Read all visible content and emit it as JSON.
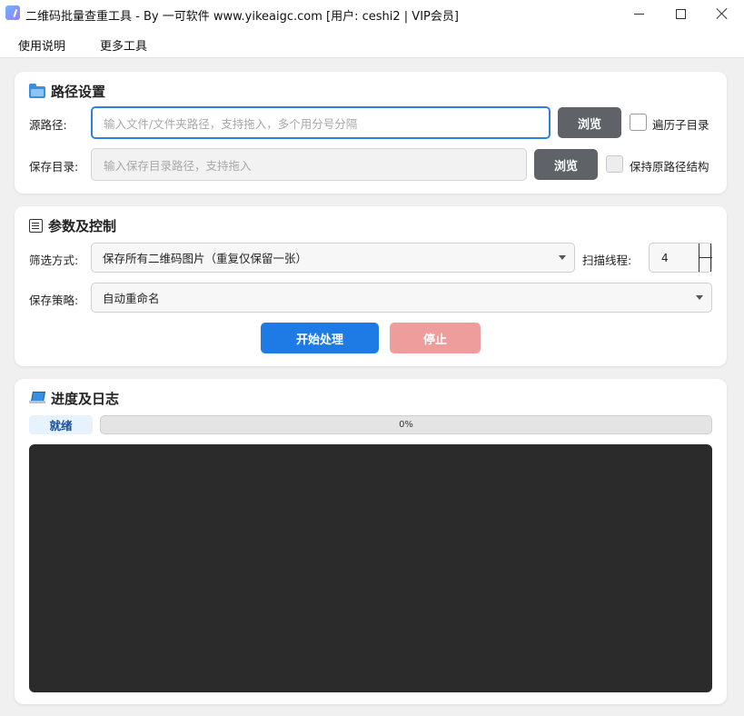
{
  "window": {
    "title": "二维码批量查重工具 - By 一可软件 www.yikeaigc.com  [用户: ceshi2 | VIP会员]",
    "controls": [
      "minimize-icon",
      "maximize-icon",
      "close-icon"
    ]
  },
  "menu": {
    "items": [
      "使用说明",
      "更多工具"
    ]
  },
  "path_section": {
    "icon": "folder-icon",
    "title": "路径设置",
    "source_label": "源路径:",
    "source_placeholder": "输入文件/文件夹路径，支持拖入，多个用分号分隔",
    "source_browse": "浏览",
    "recursive_label": "遍历子目录",
    "recursive_checked": false,
    "save_label": "保存目录:",
    "save_placeholder": "输入保存目录路径，支持拖入",
    "save_browse": "浏览",
    "keep_structure_label": "保持原路径结构",
    "keep_structure_checked": false
  },
  "params_section": {
    "icon": "list-icon",
    "title": "参数及控制",
    "filter_label": "筛选方式:",
    "filter_value": "保存所有二维码图片（重复仅保留一张）",
    "threads_label": "扫描线程:",
    "threads_value": "4",
    "policy_label": "保存策略:",
    "policy_value": "自动重命名",
    "start_button": "开始处理",
    "stop_button": "停止"
  },
  "progress_section": {
    "icon": "laptop-icon",
    "title": "进度及日志",
    "status": "就绪",
    "progress_percent": 0,
    "progress_text": "0%",
    "log_text": ""
  },
  "colors": {
    "accent": "#1e7be6",
    "stop": "#ef9c9c",
    "log_bg": "#2b2b2b",
    "browse_bg": "#5f6368"
  }
}
